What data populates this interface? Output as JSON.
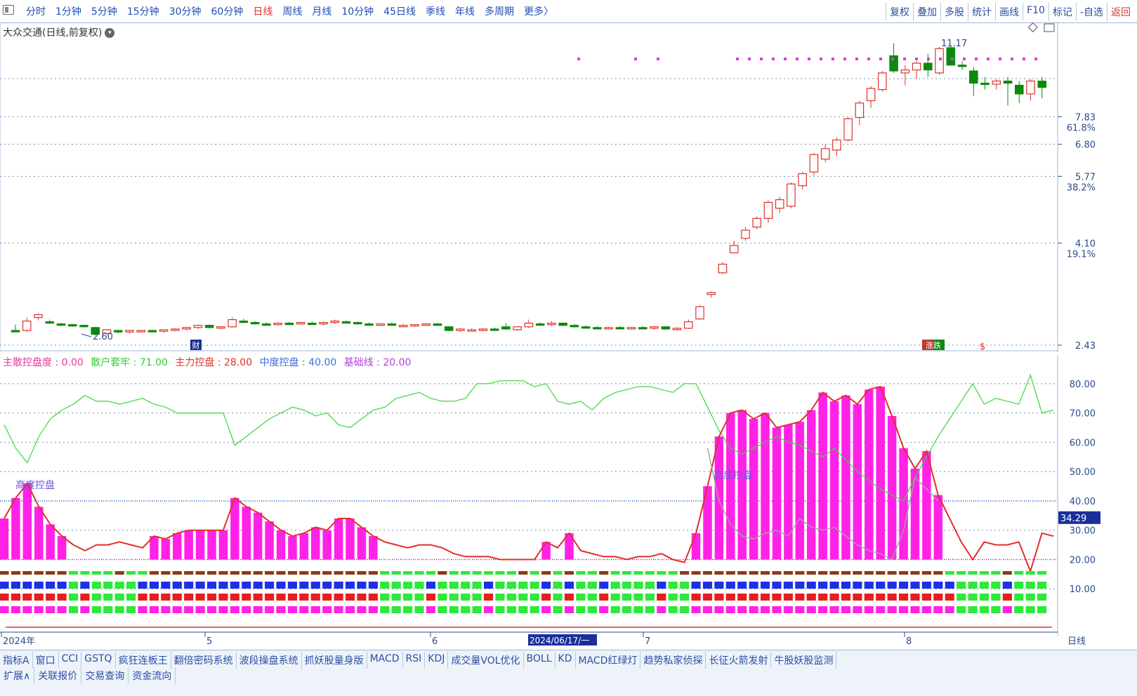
{
  "toolbar": {
    "periods": [
      "分时",
      "1分钟",
      "5分钟",
      "15分钟",
      "30分钟",
      "60分钟",
      "日线",
      "周线",
      "月线",
      "10分钟",
      "45日线",
      "季线",
      "年线",
      "多周期",
      "更多〉"
    ],
    "active_period": "日线",
    "tools": [
      "复权",
      "叠加",
      "多股",
      "统计",
      "画线",
      "F10",
      "标记",
      "-自选",
      "返回"
    ]
  },
  "chart_title": "大众交通(日线,前复权)",
  "indicator_legend": {
    "name": "主散控盘度",
    "items": [
      {
        "label": "主散控盘度",
        "value": "0.00",
        "color": "#e23b9a"
      },
      {
        "label": "散户套牢",
        "value": "71.00",
        "color": "#2fcf2f"
      },
      {
        "label": "主力控盘",
        "value": "28.00",
        "color": "#e0302b"
      },
      {
        "label": "中度控盘",
        "value": "40.00",
        "color": "#3a6fd8"
      },
      {
        "label": "基础线",
        "value": "20.00",
        "color": "#b13fd8"
      }
    ]
  },
  "bottom_tabs": [
    "指标A",
    "窗口",
    "CCI",
    "GSTQ",
    "疯狂连板王",
    "翻倍密码系统",
    "波段操盘系统",
    "抓妖股量身版",
    "MACD",
    "RSI",
    "KDJ",
    "成交量VOL优化",
    "BOLL",
    "KD",
    "MACD红绿灯",
    "趋势私家侦探",
    "长征火箭发射",
    "牛股妖股监测"
  ],
  "bottom_tabs2": [
    "扩展∧",
    "关联报价",
    "交易查询",
    "资金流向"
  ],
  "period_switch": "日线",
  "date_badge": "2024/06/17/一",
  "chart_data": [
    {
      "type": "candlestick",
      "title": "大众交通(日线,前复权)",
      "y_scale": "log",
      "y_ticks": [
        2.43,
        4.1,
        5.77,
        6.8,
        7.83
      ],
      "fib_levels": [
        {
          "label": "19.1%",
          "value": 4.1
        },
        {
          "label": "38.2%",
          "value": 5.77
        },
        {
          "label": "61.8%",
          "value": 7.83
        }
      ],
      "annotations": [
        {
          "text": "2.60",
          "value": 2.6
        },
        {
          "text": "11.17",
          "value": 11.17
        }
      ],
      "markers": [
        "财",
        "涨跌",
        "$"
      ],
      "x_labels": [
        "2024年",
        "5",
        "6",
        "7",
        "8"
      ],
      "candles": [
        [
          2.62,
          2.7,
          2.6,
          2.61
        ],
        [
          2.62,
          2.8,
          2.6,
          2.75
        ],
        [
          2.8,
          2.86,
          2.76,
          2.84
        ],
        [
          2.74,
          2.77,
          2.71,
          2.72
        ],
        [
          2.71,
          2.72,
          2.68,
          2.7
        ],
        [
          2.7,
          2.71,
          2.67,
          2.69
        ],
        [
          2.69,
          2.7,
          2.66,
          2.68
        ],
        [
          2.66,
          2.67,
          2.55,
          2.57
        ],
        [
          2.58,
          2.64,
          2.56,
          2.63
        ],
        [
          2.62,
          2.63,
          2.58,
          2.6
        ],
        [
          2.6,
          2.63,
          2.58,
          2.62
        ],
        [
          2.62,
          2.63,
          2.6,
          2.62
        ],
        [
          2.62,
          2.63,
          2.6,
          2.61
        ],
        [
          2.61,
          2.63,
          2.59,
          2.63
        ],
        [
          2.63,
          2.65,
          2.61,
          2.64
        ],
        [
          2.64,
          2.67,
          2.62,
          2.66
        ],
        [
          2.66,
          2.7,
          2.64,
          2.69
        ],
        [
          2.69,
          2.7,
          2.65,
          2.66
        ],
        [
          2.66,
          2.68,
          2.64,
          2.67
        ],
        [
          2.67,
          2.8,
          2.66,
          2.77
        ],
        [
          2.75,
          2.78,
          2.72,
          2.73
        ],
        [
          2.73,
          2.75,
          2.7,
          2.72
        ],
        [
          2.71,
          2.73,
          2.69,
          2.7
        ],
        [
          2.7,
          2.73,
          2.69,
          2.72
        ],
        [
          2.72,
          2.74,
          2.7,
          2.71
        ],
        [
          2.71,
          2.74,
          2.7,
          2.73
        ],
        [
          2.72,
          2.74,
          2.7,
          2.71
        ],
        [
          2.71,
          2.74,
          2.69,
          2.73
        ],
        [
          2.73,
          2.77,
          2.71,
          2.75
        ],
        [
          2.74,
          2.76,
          2.72,
          2.73
        ],
        [
          2.73,
          2.74,
          2.7,
          2.72
        ],
        [
          2.71,
          2.73,
          2.69,
          2.7
        ],
        [
          2.7,
          2.72,
          2.68,
          2.71
        ],
        [
          2.71,
          2.73,
          2.69,
          2.7
        ],
        [
          2.69,
          2.71,
          2.67,
          2.69
        ],
        [
          2.69,
          2.71,
          2.67,
          2.7
        ],
        [
          2.7,
          2.72,
          2.68,
          2.71
        ],
        [
          2.71,
          2.72,
          2.68,
          2.69
        ],
        [
          2.67,
          2.68,
          2.61,
          2.62
        ],
        [
          2.62,
          2.65,
          2.6,
          2.64
        ],
        [
          2.63,
          2.65,
          2.61,
          2.63
        ],
        [
          2.63,
          2.65,
          2.61,
          2.64
        ],
        [
          2.64,
          2.66,
          2.62,
          2.63
        ],
        [
          2.67,
          2.72,
          2.63,
          2.64
        ],
        [
          2.63,
          2.68,
          2.62,
          2.67
        ],
        [
          2.67,
          2.77,
          2.65,
          2.72
        ],
        [
          2.71,
          2.73,
          2.69,
          2.7
        ],
        [
          2.7,
          2.75,
          2.68,
          2.72
        ],
        [
          2.72,
          2.73,
          2.68,
          2.69
        ],
        [
          2.69,
          2.71,
          2.66,
          2.67
        ],
        [
          2.67,
          2.69,
          2.65,
          2.66
        ],
        [
          2.66,
          2.68,
          2.64,
          2.65
        ],
        [
          2.65,
          2.67,
          2.63,
          2.66
        ],
        [
          2.66,
          2.68,
          2.64,
          2.65
        ],
        [
          2.65,
          2.67,
          2.63,
          2.66
        ],
        [
          2.66,
          2.68,
          2.64,
          2.65
        ],
        [
          2.65,
          2.68,
          2.63,
          2.67
        ],
        [
          2.67,
          2.68,
          2.63,
          2.64
        ],
        [
          2.64,
          2.66,
          2.62,
          2.65
        ],
        [
          2.65,
          2.77,
          2.64,
          2.74
        ],
        [
          2.78,
          2.98,
          2.77,
          2.96
        ],
        [
          3.15,
          3.2,
          3.1,
          3.18
        ],
        [
          3.52,
          3.72,
          3.5,
          3.68
        ],
        [
          3.9,
          4.15,
          3.88,
          4.05
        ],
        [
          4.2,
          4.45,
          4.15,
          4.38
        ],
        [
          4.45,
          4.7,
          4.4,
          4.65
        ],
        [
          4.65,
          5.1,
          4.55,
          5.05
        ],
        [
          4.9,
          5.2,
          4.78,
          5.12
        ],
        [
          4.95,
          5.6,
          4.9,
          5.55
        ],
        [
          5.5,
          5.9,
          5.4,
          5.85
        ],
        [
          5.9,
          6.5,
          5.8,
          6.45
        ],
        [
          6.3,
          6.8,
          6.2,
          6.65
        ],
        [
          6.6,
          7.05,
          6.4,
          6.95
        ],
        [
          6.95,
          7.8,
          6.9,
          7.75
        ],
        [
          7.8,
          8.5,
          7.5,
          8.4
        ],
        [
          8.5,
          9.15,
          8.2,
          9.05
        ],
        [
          9.0,
          9.9,
          8.9,
          9.8
        ],
        [
          10.7,
          11.4,
          9.8,
          9.9
        ],
        [
          9.8,
          10.2,
          9.2,
          9.95
        ],
        [
          9.95,
          10.4,
          9.5,
          10.3
        ],
        [
          10.3,
          10.8,
          9.6,
          9.95
        ],
        [
          9.8,
          11.2,
          9.7,
          11.1
        ],
        [
          11.15,
          11.25,
          10.2,
          10.2
        ],
        [
          10.2,
          10.4,
          9.95,
          10.15
        ],
        [
          9.9,
          10.1,
          8.7,
          9.3
        ],
        [
          9.3,
          9.6,
          9.0,
          9.25
        ],
        [
          9.25,
          9.5,
          9.0,
          9.4
        ],
        [
          9.4,
          9.6,
          8.3,
          9.3
        ],
        [
          9.2,
          9.4,
          8.4,
          8.8
        ],
        [
          8.8,
          9.5,
          8.5,
          9.4
        ],
        [
          9.4,
          9.6,
          8.6,
          9.1
        ]
      ]
    },
    {
      "type": "bar+line",
      "title": "主散控盘度",
      "y_ticks": [
        10,
        20,
        30,
        40,
        50,
        60,
        70,
        80
      ],
      "current_value_label": "34.29",
      "text_annotations": [
        "高度控盘",
        "高度控盘"
      ],
      "series": [
        {
          "name": "主散控盘度",
          "type": "bar",
          "color": "#ff22e6",
          "values": [
            34,
            41,
            46,
            38,
            32,
            28,
            0,
            0,
            0,
            0,
            0,
            0,
            0,
            28,
            27,
            29,
            30,
            30,
            30,
            30,
            41,
            38,
            36,
            33,
            30,
            28,
            29,
            31,
            30,
            34,
            34,
            31,
            28,
            0,
            0,
            0,
            0,
            0,
            0,
            0,
            0,
            0,
            0,
            0,
            0,
            0,
            0,
            26,
            0,
            29,
            0,
            0,
            0,
            0,
            0,
            0,
            0,
            0,
            0,
            0,
            29,
            45,
            62,
            70,
            71,
            68,
            70,
            65,
            66,
            67,
            71,
            77,
            74,
            76,
            73,
            78,
            79,
            69,
            58,
            51,
            57,
            42,
            0,
            0,
            0,
            0,
            0,
            0,
            0,
            0,
            0
          ]
        },
        {
          "name": "散户套牢",
          "type": "line",
          "color": "#2fcf2f",
          "values": [
            66,
            58,
            53,
            62,
            68,
            71,
            73,
            76,
            74,
            74,
            73,
            74,
            75,
            73,
            72,
            70,
            70,
            70,
            70,
            70,
            59,
            62,
            65,
            68,
            70,
            72,
            71,
            69,
            70,
            66,
            65,
            68,
            71,
            72,
            75,
            76,
            77,
            75,
            74,
            74,
            75,
            80,
            80,
            81,
            81,
            81,
            79,
            80,
            74,
            73,
            74,
            71,
            75,
            77,
            78,
            79,
            79,
            78,
            77,
            80,
            80,
            72,
            64,
            58,
            56,
            58,
            60,
            62,
            60,
            59,
            57,
            55,
            58,
            54,
            50,
            47,
            44,
            42,
            40,
            48,
            55,
            62,
            68,
            74,
            80,
            73,
            75,
            74,
            73,
            83,
            70,
            71
          ]
        },
        {
          "name": "主力控盘",
          "type": "line",
          "color": "#e0302b",
          "values": [
            34,
            41,
            46,
            38,
            32,
            28,
            25,
            23,
            25,
            25,
            26,
            25,
            24,
            28,
            27,
            29,
            30,
            30,
            30,
            30,
            41,
            38,
            36,
            33,
            30,
            28,
            29,
            31,
            30,
            34,
            34,
            31,
            28,
            26,
            25,
            24,
            25,
            25,
            24,
            22,
            21,
            21,
            21,
            20,
            20,
            20,
            20,
            26,
            24,
            29,
            23,
            22,
            21,
            21,
            20,
            21,
            21,
            22,
            20,
            19,
            29,
            45,
            62,
            70,
            71,
            68,
            70,
            65,
            66,
            67,
            71,
            77,
            74,
            76,
            73,
            78,
            79,
            69,
            58,
            51,
            57,
            42,
            34,
            26,
            20,
            26,
            25,
            25,
            26,
            16,
            29,
            28
          ]
        },
        {
          "name": "中度控盘",
          "type": "line",
          "color": "#3a6fd8",
          "values": [
            40
          ]
        },
        {
          "name": "基础线",
          "type": "line",
          "color": "#b13fd8",
          "values": [
            20
          ]
        }
      ],
      "signal_rows": [
        {
          "row": 1,
          "colors": [
            "#8b3a1a",
            "#2ee83a"
          ]
        },
        {
          "row": 2,
          "colors": [
            "#1d2fe8",
            "#2ee83a"
          ]
        },
        {
          "row": 3,
          "colors": [
            "#e81d1d",
            "#2ee83a"
          ]
        },
        {
          "row": 4,
          "colors": [
            "#ff22e6",
            "#2ee83a"
          ]
        }
      ]
    }
  ]
}
